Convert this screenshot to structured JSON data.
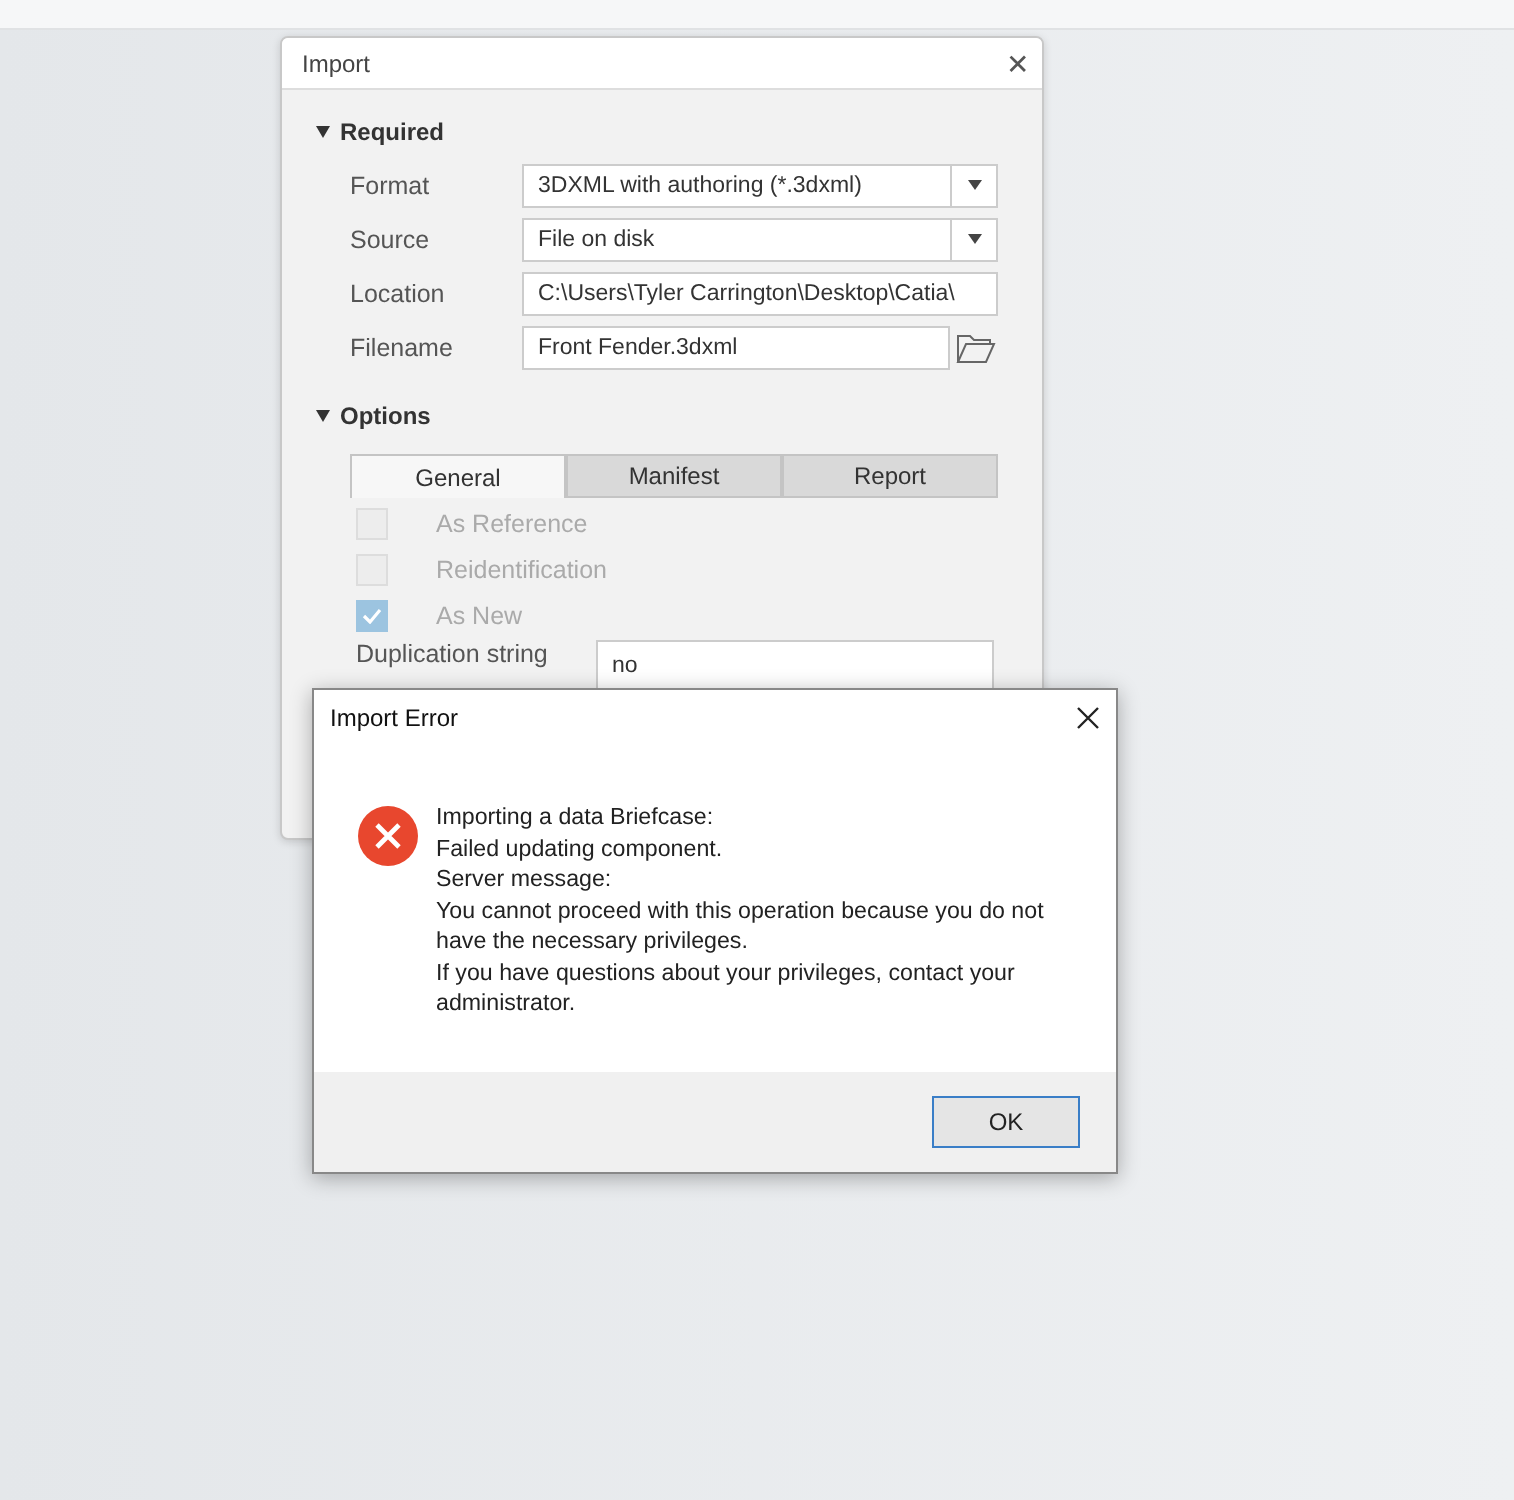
{
  "import_dialog": {
    "title": "Import",
    "close": "✕",
    "required": {
      "heading": "Required",
      "expanded": true,
      "fields": [
        {
          "kind": "dropdown",
          "label": "Format",
          "value": "3DXML with authoring (*.3dxml)"
        },
        {
          "kind": "dropdown",
          "label": "Source",
          "value": "File on disk"
        },
        {
          "kind": "text",
          "label": "Location",
          "value": "C:\\Users\\Tyler Carrington\\Desktop\\Catia\\"
        },
        {
          "kind": "file",
          "label": "Filename",
          "value": "Front Fender.3dxml"
        }
      ]
    },
    "options": {
      "heading": "Options",
      "expanded": true,
      "tabs": [
        {
          "label": "General",
          "selected": true
        },
        {
          "label": "Manifest",
          "selected": false
        },
        {
          "label": "Report",
          "selected": false
        }
      ],
      "checkboxes": [
        {
          "label": "As Reference",
          "checked": false,
          "disabled": true
        },
        {
          "label": "Reidentification",
          "checked": false,
          "disabled": true
        },
        {
          "label": "As New",
          "checked": true,
          "disabled": true
        }
      ],
      "duplication": {
        "label": "Duplication string",
        "value": "no"
      }
    }
  },
  "error_dialog": {
    "title": "Import Error",
    "lines": [
      "Importing a data Briefcase:",
      "Failed updating component.",
      "Server message:",
      "You cannot proceed with this operation because you do not have the necessary privileges.",
      "If you have questions about your privileges, contact your administrator."
    ],
    "button": "OK"
  }
}
